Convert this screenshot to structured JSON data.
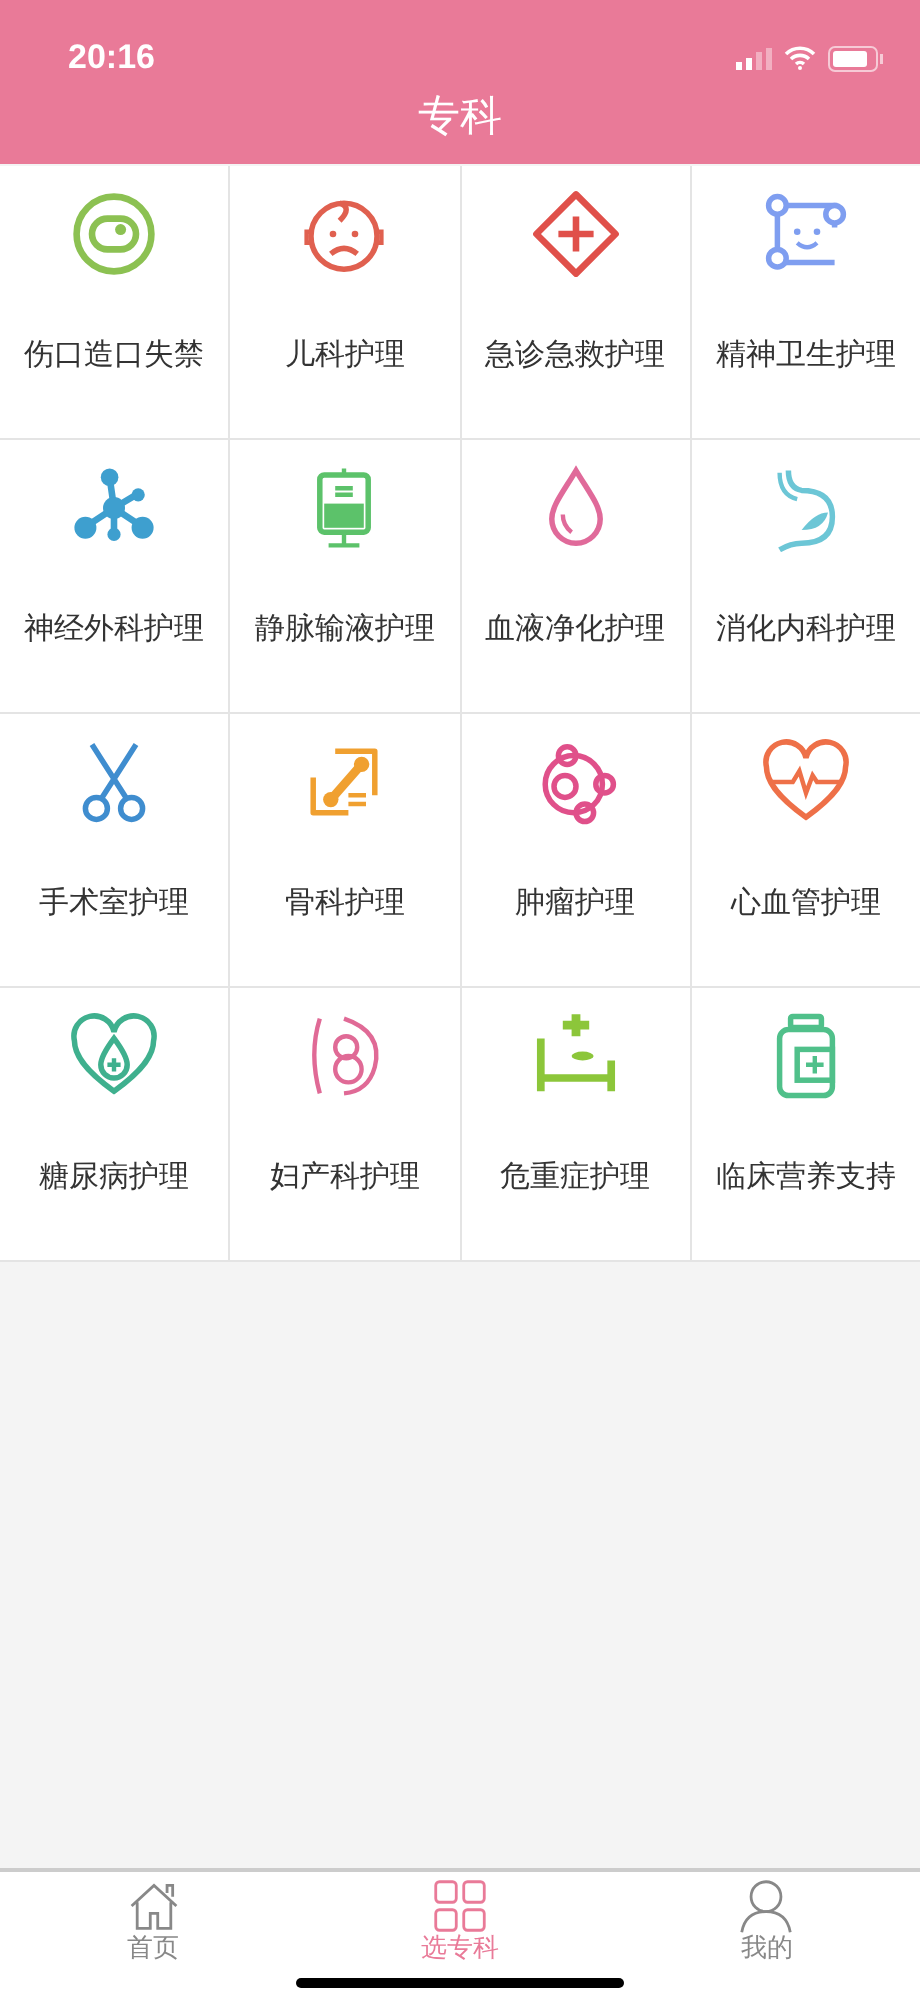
{
  "status_bar": {
    "time": "20:16"
  },
  "header": {
    "title": "专科"
  },
  "specialties": [
    {
      "label": "伤口造口失禁",
      "color": "#8cc152"
    },
    {
      "label": "儿科护理",
      "color": "#e0604f"
    },
    {
      "label": "急诊急救护理",
      "color": "#e0504a"
    },
    {
      "label": "精神卫生护理",
      "color": "#7f9ef0"
    },
    {
      "label": "神经外科护理",
      "color": "#3e9fcf"
    },
    {
      "label": "静脉输液护理",
      "color": "#5cc26a"
    },
    {
      "label": "血液净化护理",
      "color": "#e06a9a"
    },
    {
      "label": "消化内科护理",
      "color": "#6cc6d6"
    },
    {
      "label": "手术室护理",
      "color": "#3f8dcf"
    },
    {
      "label": "骨科护理",
      "color": "#f0a030"
    },
    {
      "label": "肿瘤护理",
      "color": "#e0508a"
    },
    {
      "label": "心血管护理",
      "color": "#ee7048"
    },
    {
      "label": "糖尿病护理",
      "color": "#3fb08e"
    },
    {
      "label": "妇产科护理",
      "color": "#e06a96"
    },
    {
      "label": "危重症护理",
      "color": "#8cc63a"
    },
    {
      "label": "临床营养支持",
      "color": "#50c08a"
    }
  ],
  "tab_bar": [
    {
      "label": "首页",
      "selected": false
    },
    {
      "label": "选专科",
      "selected": true
    },
    {
      "label": "我的",
      "selected": false
    }
  ]
}
